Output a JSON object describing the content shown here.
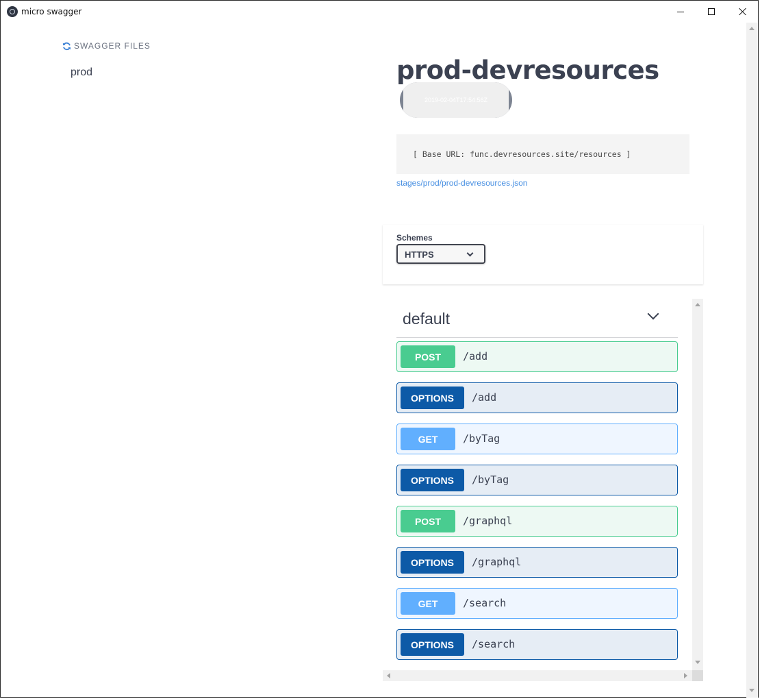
{
  "window": {
    "title": "micro swagger"
  },
  "sidebar": {
    "title": "SWAGGER FILES",
    "items": [
      {
        "label": "prod"
      }
    ]
  },
  "info": {
    "title": "prod-devresources",
    "version": "2019-02-04T17:54:56Z",
    "base_url": "[ Base URL: func.devresources.site/resources ]",
    "spec_link": "stages/prod/prod-devresources.json"
  },
  "schemes": {
    "label": "Schemes",
    "selected": "HTTPS"
  },
  "tag": {
    "name": "default"
  },
  "operations": [
    {
      "method": "POST",
      "path": "/add"
    },
    {
      "method": "OPTIONS",
      "path": "/add"
    },
    {
      "method": "GET",
      "path": "/byTag"
    },
    {
      "method": "OPTIONS",
      "path": "/byTag"
    },
    {
      "method": "POST",
      "path": "/graphql"
    },
    {
      "method": "OPTIONS",
      "path": "/graphql"
    },
    {
      "method": "GET",
      "path": "/search"
    },
    {
      "method": "OPTIONS",
      "path": "/search"
    }
  ],
  "colors": {
    "post": "#49cc90",
    "get": "#61affe",
    "options": "#0d5aa7",
    "link": "#4990e2",
    "text": "#3b4151"
  }
}
